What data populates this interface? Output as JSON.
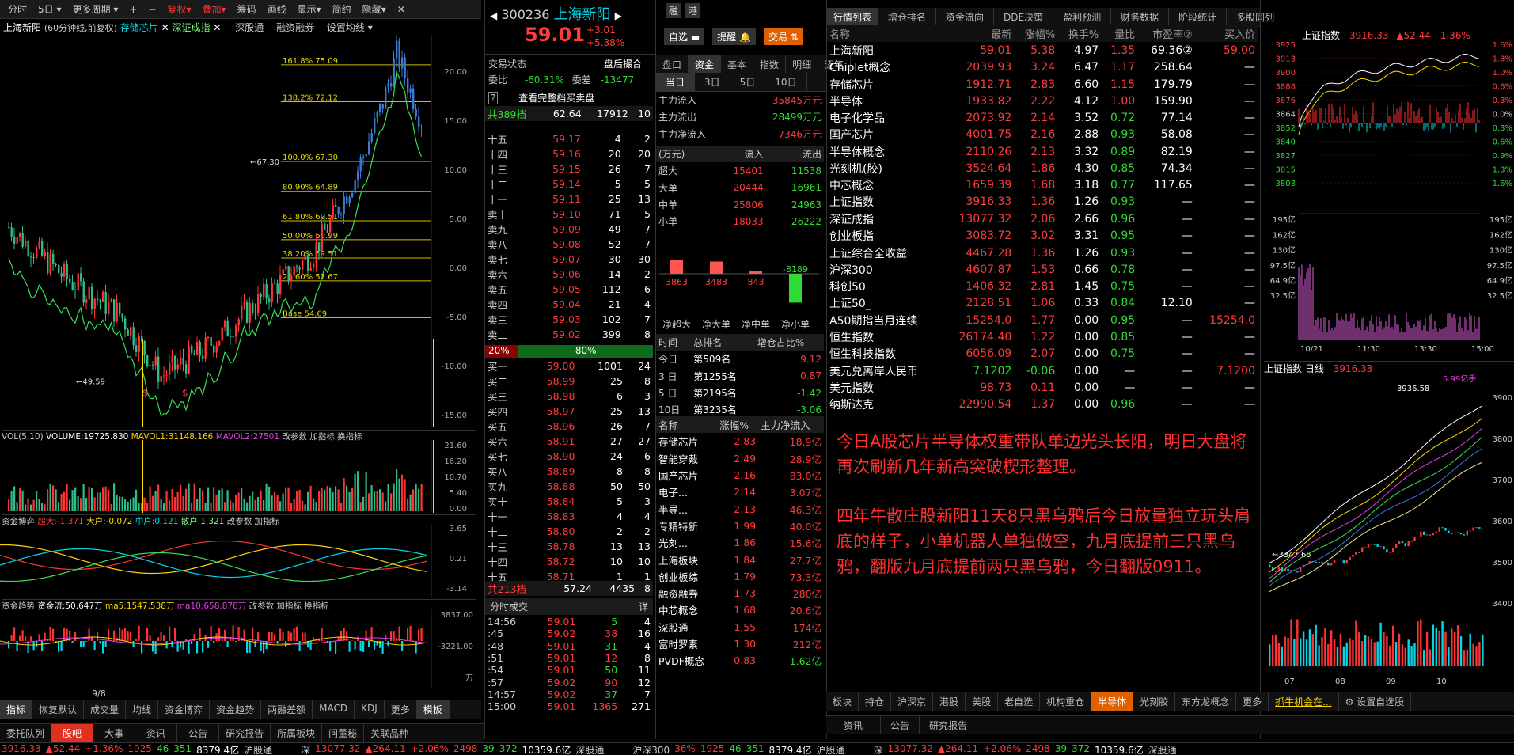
{
  "toolbar": {
    "buttons": [
      "分时",
      "5日",
      "更多周期",
      "+",
      "−",
      "复权",
      "叠加",
      "筹码",
      "画线",
      "显示",
      "简约",
      "隐藏"
    ],
    "stock_label": "上海新阳",
    "chart_note": "(60分钟线,前复权)",
    "overlay1": "存储芯片",
    "overlay2": "深证成指",
    "links": [
      "深股通",
      "融资融券",
      "设置均线"
    ]
  },
  "kline": {
    "fib": [
      "161.8% 75.09",
      "138.2% 72.12",
      "100.0% 67.30",
      "80.90% 64.89",
      "61.80% 62.51",
      "50.00% 60.99",
      "38.20% 59.51",
      "23.60% 57.67",
      "Base  54.69"
    ],
    "high_label": "67.30",
    "low_label": "49.59",
    "right_axis": [
      "20.00",
      "15.00",
      "10.00",
      "5.00",
      "0.00",
      "-5.00",
      "-10.00",
      "-15.00"
    ],
    "date_label": "9/8"
  },
  "vol": {
    "title": "VOL(5,10)",
    "volume": "VOLUME:19725.830",
    "mavol1": "MAVOL1:31148.166",
    "mavol2": "MAVOL2:27501",
    "links": "改参数  加指标  换指标",
    "axis": [
      "21.60",
      "16.20",
      "10.70",
      "5.40",
      "0.00"
    ]
  },
  "zjbo": {
    "title": "资金博弈",
    "super": "超大:-1.371",
    "big": "大户:-0.072",
    "mid": "中户:0.121",
    "small": "散户:1.321",
    "links": "改参数  加指标",
    "axis": [
      "3.65",
      "0.21",
      "-3.14"
    ]
  },
  "zjqs": {
    "title": "资金趋势",
    "flow": "资金流:50.647万",
    "ma5": "ma5:1547.538万",
    "ma10": "ma10:658.878万",
    "links": "改参数  加指标  换指标",
    "axis": [
      "3837.00",
      "-3221.00",
      "万"
    ]
  },
  "bottom_tabs": [
    "指标",
    "恢复默认",
    "成交量",
    "均线",
    "资金博弈",
    "资金趋势",
    "两融差额",
    "MACD",
    "KDJ",
    "更多",
    "模板"
  ],
  "bottom_tabs2": [
    "委托队列",
    "股吧",
    "大事",
    "资讯",
    "公告",
    "研究报告",
    "所属板块",
    "问董秘",
    "关联品种"
  ],
  "quote": {
    "code": "300236",
    "name": "上海新阳",
    "tags": [
      "融",
      "港"
    ],
    "price": "59.01",
    "change": "+3.01",
    "pct": "+5.38%",
    "zixuan": "自选",
    "tixing": "提醒",
    "jiaoyi": "交易",
    "state_label": "交易状态",
    "state": "盘后撮合",
    "weibi_label": "委比",
    "weibi": "-60.31%",
    "weicha_label": "委差",
    "weicha": "-13477",
    "full_btn": "查看完整档买卖盘",
    "sell_total": [
      "共389档",
      "62.64",
      "17912",
      "10"
    ],
    "buy_total": [
      "共213档",
      "57.24",
      "4435",
      "8"
    ],
    "bar_left": "20%",
    "bar_right": "80%",
    "sells": [
      [
        "十五",
        "59.17",
        "4",
        "2"
      ],
      [
        "十四",
        "59.16",
        "20",
        "20"
      ],
      [
        "十三",
        "59.15",
        "26",
        "7"
      ],
      [
        "十二",
        "59.14",
        "5",
        "5"
      ],
      [
        "十一",
        "59.11",
        "25",
        "13"
      ],
      [
        "卖十",
        "59.10",
        "71",
        "5"
      ],
      [
        "卖九",
        "59.09",
        "49",
        "7"
      ],
      [
        "卖八",
        "59.08",
        "52",
        "7"
      ],
      [
        "卖七",
        "59.07",
        "30",
        "30"
      ],
      [
        "卖六",
        "59.06",
        "14",
        "2"
      ],
      [
        "卖五",
        "59.05",
        "112",
        "6"
      ],
      [
        "卖四",
        "59.04",
        "21",
        "4"
      ],
      [
        "卖三",
        "59.03",
        "102",
        "7"
      ],
      [
        "卖二",
        "59.02",
        "399",
        "8"
      ],
      [
        "卖一",
        "59.01",
        "130",
        "3"
      ]
    ],
    "buys": [
      [
        "买一",
        "59.00",
        "1001",
        "24"
      ],
      [
        "买二",
        "58.99",
        "25",
        "8"
      ],
      [
        "买三",
        "58.98",
        "6",
        "3"
      ],
      [
        "买四",
        "58.97",
        "25",
        "13"
      ],
      [
        "买五",
        "58.96",
        "26",
        "7"
      ],
      [
        "买六",
        "58.91",
        "27",
        "27"
      ],
      [
        "买七",
        "58.90",
        "24",
        "6"
      ],
      [
        "买八",
        "58.89",
        "8",
        "8"
      ],
      [
        "买九",
        "58.88",
        "50",
        "50"
      ],
      [
        "买十",
        "58.84",
        "5",
        "3"
      ],
      [
        "十一",
        "58.83",
        "4",
        "4"
      ],
      [
        "十二",
        "58.80",
        "2",
        "2"
      ],
      [
        "十三",
        "58.78",
        "13",
        "13"
      ],
      [
        "十四",
        "58.72",
        "10",
        "10"
      ],
      [
        "十五",
        "58.71",
        "1",
        "1"
      ]
    ],
    "ticks_title": "分时成交",
    "ticks_detail": "详",
    "ticks": [
      [
        "14:56",
        "59.01",
        "5",
        "4"
      ],
      [
        ":45",
        "59.02",
        "38",
        "16"
      ],
      [
        ":48",
        "59.01",
        "31",
        "4"
      ],
      [
        ":51",
        "59.01",
        "12",
        "8"
      ],
      [
        ":54",
        "59.01",
        "50",
        "11"
      ],
      [
        ":57",
        "59.02",
        "90",
        "12"
      ],
      [
        "14:57",
        "59.02",
        "37",
        "7"
      ],
      [
        "15:00",
        "59.01",
        "1365",
        "271"
      ]
    ]
  },
  "fund": {
    "tabs": [
      "盘口",
      "资金",
      "基本",
      "指数",
      "明细",
      "逐笔"
    ],
    "periods": [
      "当日",
      "3日",
      "5日",
      "10日"
    ],
    "main_in_label": "主力流入",
    "main_in": "35845万元",
    "main_out_label": "主力流出",
    "main_out": "28499万元",
    "main_net_label": "主力净流入",
    "main_net": "7346万元",
    "unit": "(万元)",
    "in_h": "流入",
    "out_h": "流出",
    "rows": [
      [
        "超大",
        "15401",
        "11538"
      ],
      [
        "大单",
        "20444",
        "16961"
      ],
      [
        "中单",
        "25806",
        "24963"
      ],
      [
        "小单",
        "18033",
        "26222"
      ]
    ],
    "bars": [
      {
        "label": "净超大",
        "value": 3863
      },
      {
        "label": "净大单",
        "value": 3483
      },
      {
        "label": "净中单",
        "value": 843
      },
      {
        "label": "净小单",
        "value": -8189
      }
    ],
    "rank_head": [
      "时间",
      "总排名",
      "增仓占比%"
    ],
    "rank": [
      [
        "今日",
        "第509名",
        "9.12"
      ],
      [
        "3 日",
        "第1255名",
        "0.87"
      ],
      [
        "5 日",
        "第2195名",
        "-1.42"
      ],
      [
        "10日",
        "第3235名",
        "-3.06"
      ]
    ],
    "sector_head": [
      "名称",
      "涨幅%",
      "主力净流入"
    ],
    "sectors": [
      [
        "存储芯片",
        "2.83",
        "18.9亿"
      ],
      [
        "智能穿戴",
        "2.49",
        "28.9亿"
      ],
      [
        "国产芯片",
        "2.16",
        "83.0亿"
      ],
      [
        "电子...",
        "2.14",
        "3.07亿"
      ],
      [
        "半导...",
        "2.13",
        "46.3亿"
      ],
      [
        "专精特新",
        "1.99",
        "40.0亿"
      ],
      [
        "光刻...",
        "1.86",
        "15.6亿"
      ],
      [
        "上海板块",
        "1.84",
        "27.7亿"
      ],
      [
        "创业板综",
        "1.79",
        "73.3亿"
      ],
      [
        "融资融券",
        "1.73",
        "280亿"
      ],
      [
        "中芯概念",
        "1.68",
        "20.6亿"
      ],
      [
        "深股通",
        "1.55",
        "174亿"
      ],
      [
        "富时罗素",
        "1.30",
        "212亿"
      ],
      [
        "PVDF概念",
        "0.83",
        "-1.62亿"
      ]
    ]
  },
  "market": {
    "tabs": [
      "行情列表",
      "增仓排名",
      "资金流向",
      "DDE决策",
      "盈利预测",
      "财务数据",
      "阶段统计",
      "多股同列"
    ],
    "head": [
      "名称",
      "最新",
      "涨幅%",
      "换手%",
      "量比",
      "市盈率②",
      "买入价"
    ],
    "rows": [
      [
        "上海新阳",
        "59.01",
        "5.38",
        "4.97",
        "1.35",
        "69.36②",
        "59.00"
      ],
      [
        "Chiplet概念",
        "2039.93",
        "3.24",
        "6.47",
        "1.17",
        "258.64",
        "—"
      ],
      [
        "存储芯片",
        "1912.71",
        "2.83",
        "6.60",
        "1.15",
        "179.79",
        "—"
      ],
      [
        "半导体",
        "1933.82",
        "2.22",
        "4.12",
        "1.00",
        "159.90",
        "—"
      ],
      [
        "电子化学品",
        "2073.92",
        "2.14",
        "3.52",
        "0.72",
        "77.14",
        "—"
      ],
      [
        "国产芯片",
        "4001.75",
        "2.16",
        "2.88",
        "0.93",
        "58.08",
        "—"
      ],
      [
        "半导体概念",
        "2110.26",
        "2.13",
        "3.32",
        "0.89",
        "82.19",
        "—"
      ],
      [
        "光刻机(胶)",
        "3524.64",
        "1.86",
        "4.30",
        "0.85",
        "74.34",
        "—"
      ],
      [
        "中芯概念",
        "1659.39",
        "1.68",
        "3.18",
        "0.77",
        "117.65",
        "—"
      ],
      [
        "上证指数",
        "3916.33",
        "1.36",
        "1.26",
        "0.93",
        "—",
        "—"
      ],
      [
        "深证成指",
        "13077.32",
        "2.06",
        "2.66",
        "0.96",
        "—",
        "—"
      ],
      [
        "创业板指",
        "3083.72",
        "3.02",
        "3.31",
        "0.95",
        "—",
        "—"
      ],
      [
        "上证综合全收益",
        "4467.28",
        "1.36",
        "1.26",
        "0.93",
        "—",
        "—"
      ],
      [
        "沪深300",
        "4607.87",
        "1.53",
        "0.66",
        "0.78",
        "—",
        "—"
      ],
      [
        "科创50",
        "1406.32",
        "2.81",
        "1.45",
        "0.75",
        "—",
        "—"
      ],
      [
        "上证50_",
        "2128.51",
        "1.06",
        "0.33",
        "0.84",
        "12.10",
        "—"
      ],
      [
        "A50期指当月连续",
        "15254.0",
        "1.77",
        "0.00",
        "0.95",
        "—",
        "15254.0"
      ],
      [
        "恒生指数",
        "26174.40",
        "1.22",
        "0.00",
        "0.85",
        "—",
        "—"
      ],
      [
        "恒生科技指数",
        "6056.09",
        "2.07",
        "0.00",
        "0.75",
        "—",
        "—"
      ],
      [
        "美元兑离岸人民币",
        "7.1202",
        "-0.06",
        "0.00",
        "—",
        "—",
        "7.1200"
      ],
      [
        "美元指数",
        "98.73",
        "0.11",
        "0.00",
        "—",
        "—",
        "—"
      ],
      [
        "纳斯达克",
        "22990.54",
        "1.37",
        "0.00",
        "0.96",
        "—",
        "—"
      ]
    ],
    "tabs_bottom": [
      "板块",
      "持仓",
      "沪深京",
      "港股",
      "美股",
      "老自选",
      "机构重仓",
      "半导体",
      "光刻胶",
      "东方龙概念",
      "更多",
      "抓牛机会在...",
      "设置自选股"
    ],
    "tabs_bottom2": [
      "资讯",
      "公告",
      "研究报告"
    ]
  },
  "annotation": {
    "p1": "今日A股芯片半导体权重带队单边光头长阳，明日大盘将再次刷新几年新高突破楔形整理。",
    "p2": "四年牛散庄股新阳11天8只黑乌鸦后今日放量独立玩头肩底的样子，小单机器人单独做空，九月底提前三只黑乌鸦，翻版九月底提前两只黑乌鸦，今日翻版0911。"
  },
  "index_mini": {
    "title": "上证指数",
    "price": "3916.33",
    "chg": "52.44",
    "pct": "1.36%",
    "left_axis": [
      "3925",
      "3913",
      "3900",
      "3888",
      "3876",
      "3864",
      "3852",
      "3840",
      "3827",
      "3815",
      "3803",
      "195亿",
      "162亿",
      "130亿",
      "97.5亿",
      "64.9亿",
      "32.5亿"
    ],
    "right_axis": [
      "1.6%",
      "1.3%",
      "1.0%",
      "0.6%",
      "0.3%",
      "0.0%",
      "0.3%",
      "0.6%",
      "0.9%",
      "1.3%",
      "1.6%",
      "195亿",
      "162亿",
      "130亿",
      "97.5亿",
      "64.9亿",
      "32.5亿"
    ],
    "times": [
      "10/21",
      "11:30",
      "13:30",
      "15:00"
    ]
  },
  "index_daily": {
    "title": "上证指数 日线",
    "price": "3916.33",
    "peak": "3936.58",
    "low": "3347.65",
    "vol": "5.99亿手",
    "axis": [
      "3900",
      "3800",
      "3700",
      "3600",
      "3500",
      "3400"
    ],
    "months": [
      "07",
      "08",
      "09",
      "10"
    ]
  },
  "status": {
    "left": "3916.33",
    "left_chg": "52.44",
    "left_pct": "+1.36%",
    "left_n": [
      "1925",
      "46",
      "351"
    ],
    "left_amt": "8379.4亿",
    "hgt": "沪股通",
    "shen": "深",
    "shen_val": "13077.32",
    "shen_chg": "264.11",
    "shen_pct": "+2.06%",
    "shen_n": [
      "2498",
      "39",
      "372"
    ],
    "shen_amt": "10359.6亿",
    "sgt": "深股通",
    "mid": "沪深300",
    "right_pct": "36%",
    "right_n": [
      "1925",
      "46",
      "351"
    ],
    "right_amt": "8379.4亿"
  }
}
